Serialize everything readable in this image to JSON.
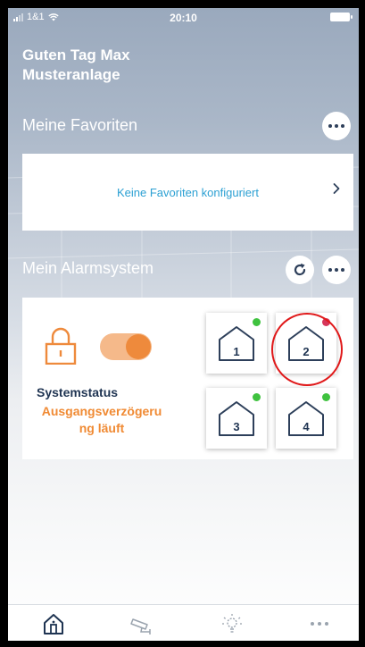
{
  "status_bar": {
    "carrier": "1&1",
    "time": "20:10"
  },
  "header": {
    "greeting": "Guten Tag Max",
    "installation": "Musteranlage"
  },
  "favorites": {
    "title": "Meine Favoriten",
    "empty_text": "Keine Favoriten konfiguriert"
  },
  "alarm": {
    "title": "Mein Alarmsystem",
    "system_status_label": "Systemstatus",
    "system_status_value_line1": "Ausgangsverzögeru",
    "system_status_value_line2": "ng läuft",
    "zones": [
      {
        "label": "1",
        "status_color": "#3fc23f"
      },
      {
        "label": "2",
        "status_color": "#d6365a"
      },
      {
        "label": "3",
        "status_color": "#3fc23f"
      },
      {
        "label": "4",
        "status_color": "#3fc23f"
      }
    ]
  },
  "colors": {
    "accent_orange": "#ee8a3c",
    "navy": "#1f3452",
    "link_blue": "#2ca0d3",
    "highlight_red": "#e0191a"
  },
  "tabbar": {
    "items": [
      "home-icon",
      "camera-icon",
      "lightbulb-icon",
      "more-icon"
    ]
  }
}
